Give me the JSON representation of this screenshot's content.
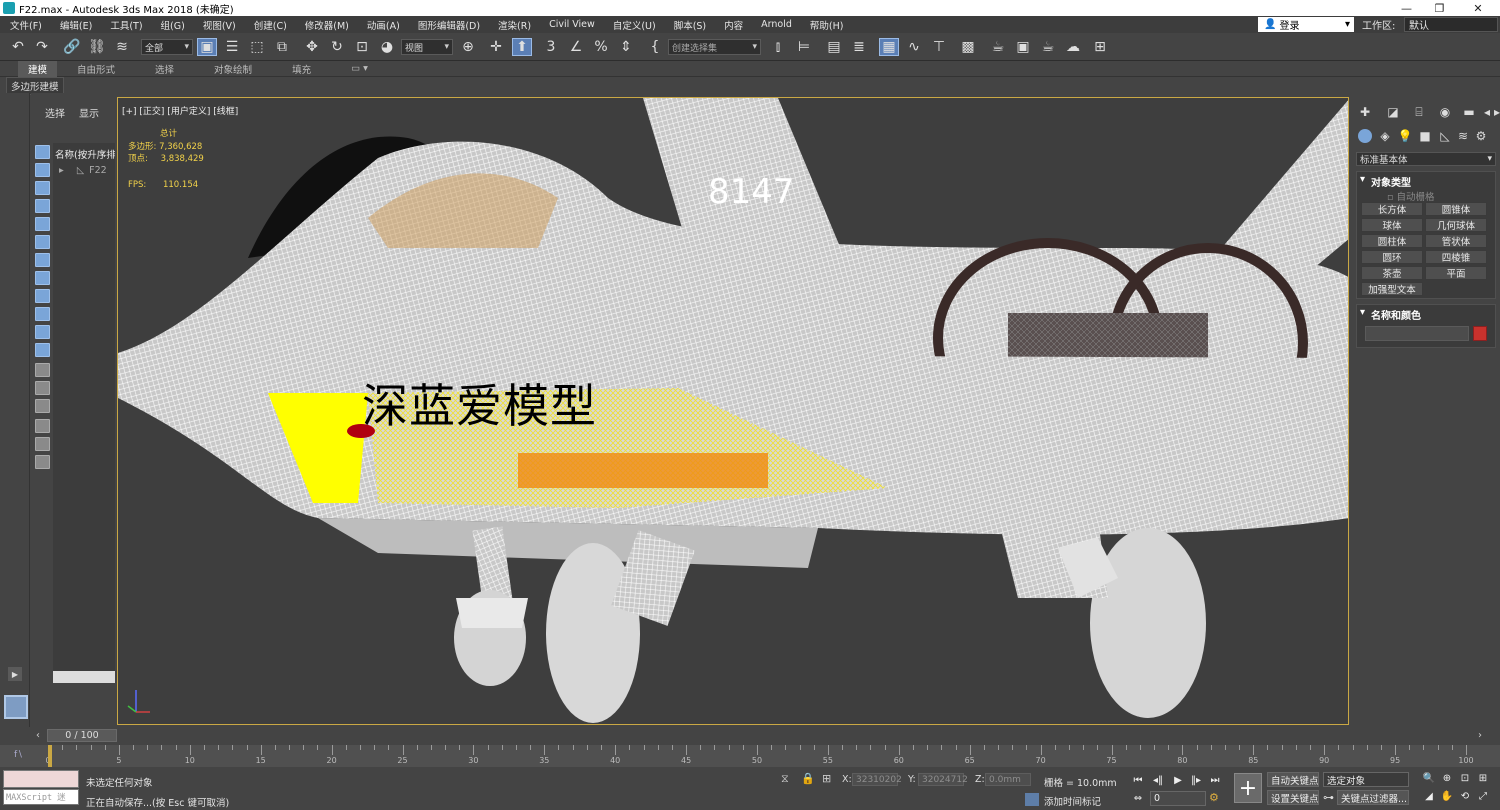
{
  "window": {
    "title": "F22.max - Autodesk 3ds Max 2018  (未确定)",
    "buttons": [
      "—",
      "❐",
      "✕"
    ]
  },
  "menu": {
    "items": [
      "文件(F)",
      "编辑(E)",
      "工具(T)",
      "组(G)",
      "视图(V)",
      "创建(C)",
      "修改器(M)",
      "动画(A)",
      "图形编辑器(D)",
      "渲染(R)",
      "Civil View",
      "自定义(U)",
      "脚本(S)",
      "内容",
      "Arnold",
      "帮助(H)"
    ],
    "login": "登录",
    "workspace_label": "工作区:",
    "workspace_value": "默认"
  },
  "toolbar": {
    "filter_value": "全部",
    "view_value": "视图",
    "selection_set_placeholder": "创建选择集"
  },
  "ribbon": {
    "tabs": [
      "建模",
      "自由形式",
      "选择",
      "对象绘制",
      "填充"
    ],
    "active_tab": "建模",
    "sub_label": "多边形建模"
  },
  "explorer": {
    "tabs": [
      "选择",
      "显示"
    ],
    "header": "名称(按升序排",
    "item": "F22"
  },
  "viewport": {
    "label": "[+] [正交] [用户定义] [线框]",
    "stats": {
      "total_label": "总计",
      "polys_label": "多边形:",
      "polys_value": "7,360,628",
      "verts_label": "顶点:",
      "verts_value": "3,838,429",
      "fps_label": "FPS:",
      "fps_value": "110.154"
    },
    "watermark": "深蓝爱模型"
  },
  "command_panel": {
    "category": "标准基本体",
    "object_type_title": "对象类型",
    "autogrid": "自动栅格",
    "buttons": [
      "长方体",
      "圆锥体",
      "球体",
      "几何球体",
      "圆柱体",
      "管状体",
      "圆环",
      "四棱锥",
      "茶壶",
      "平面",
      "加强型文本"
    ],
    "name_color_title": "名称和颜色",
    "object_color": "#c8322d"
  },
  "timeline": {
    "frame": "0 / 100",
    "ticks": [
      0,
      5,
      10,
      15,
      20,
      25,
      30,
      35,
      40,
      45,
      50,
      55,
      60,
      65,
      70,
      75,
      80,
      85,
      90,
      95,
      100
    ]
  },
  "status": {
    "maxscript": "MAXScript 迷",
    "line1": "未选定任何对象",
    "line2": "正在自动保存...(按 Esc 键可取消)",
    "x_label": "X:",
    "x_value": "32310202",
    "y_label": "Y:",
    "y_value": "32024712",
    "z_label": "Z:",
    "z_value": "0.0mm",
    "grid": "栅格 = 10.0mm",
    "add_time_tag": "添加时间标记",
    "auto_key": "自动关键点",
    "set_key": "设置关键点",
    "selected_object": "选定对象",
    "key_filters": "关键点过滤器...",
    "frame_field": "0"
  },
  "colors": {
    "viewport_border": "#caa844",
    "stats_text": "#f2d24a",
    "active_button": "#5b7fb5"
  }
}
